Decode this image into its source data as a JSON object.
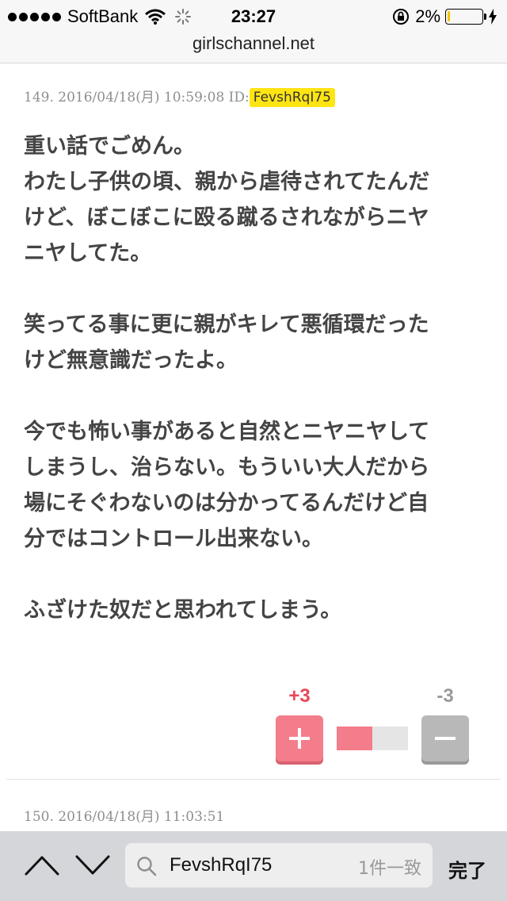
{
  "status_bar": {
    "carrier": "SoftBank",
    "time": "23:27",
    "battery_percent": "2%",
    "battery_level": 0.02,
    "battery_color": "#f5c400"
  },
  "url_bar": {
    "domain": "girlschannel.net"
  },
  "comment": {
    "header": "149. 2016/04/18(月) 10:59:08 ID:",
    "user_id": "FevshRqI75",
    "lines": [
      "重い話でごめん。",
      "わたし子供の頃、親から虐待されてたんだ",
      "けど、ぼこぼこに殴る蹴るされながらニヤ",
      "ニヤしてた。",
      "",
      "笑ってる事に更に親がキレて悪循環だった",
      "けど無意識だったよ。",
      "",
      "今でも怖い事があると自然とニヤニヤして",
      "しまうし、治らない。もういい大人だから",
      "場にそぐわないのは分かってるんだけど自",
      "分ではコントロール出来ない。",
      "",
      "ふざけた奴だと思われてしまう。"
    ],
    "plus_count": "+3",
    "minus_count": "-3",
    "plus_ratio": 0.5,
    "colors": {
      "plus": "#f47d8b",
      "minus": "#b8b8b8",
      "id_highlight": "#ffe414"
    }
  },
  "next_comment": {
    "header": "150. 2016/04/18(月) 11:03:51"
  },
  "find_bar": {
    "prev_icon": "chevron-up-icon",
    "next_icon": "chevron-down-icon",
    "query": "FevshRqI75",
    "match_count": "1件一致",
    "done_label": "完了"
  }
}
